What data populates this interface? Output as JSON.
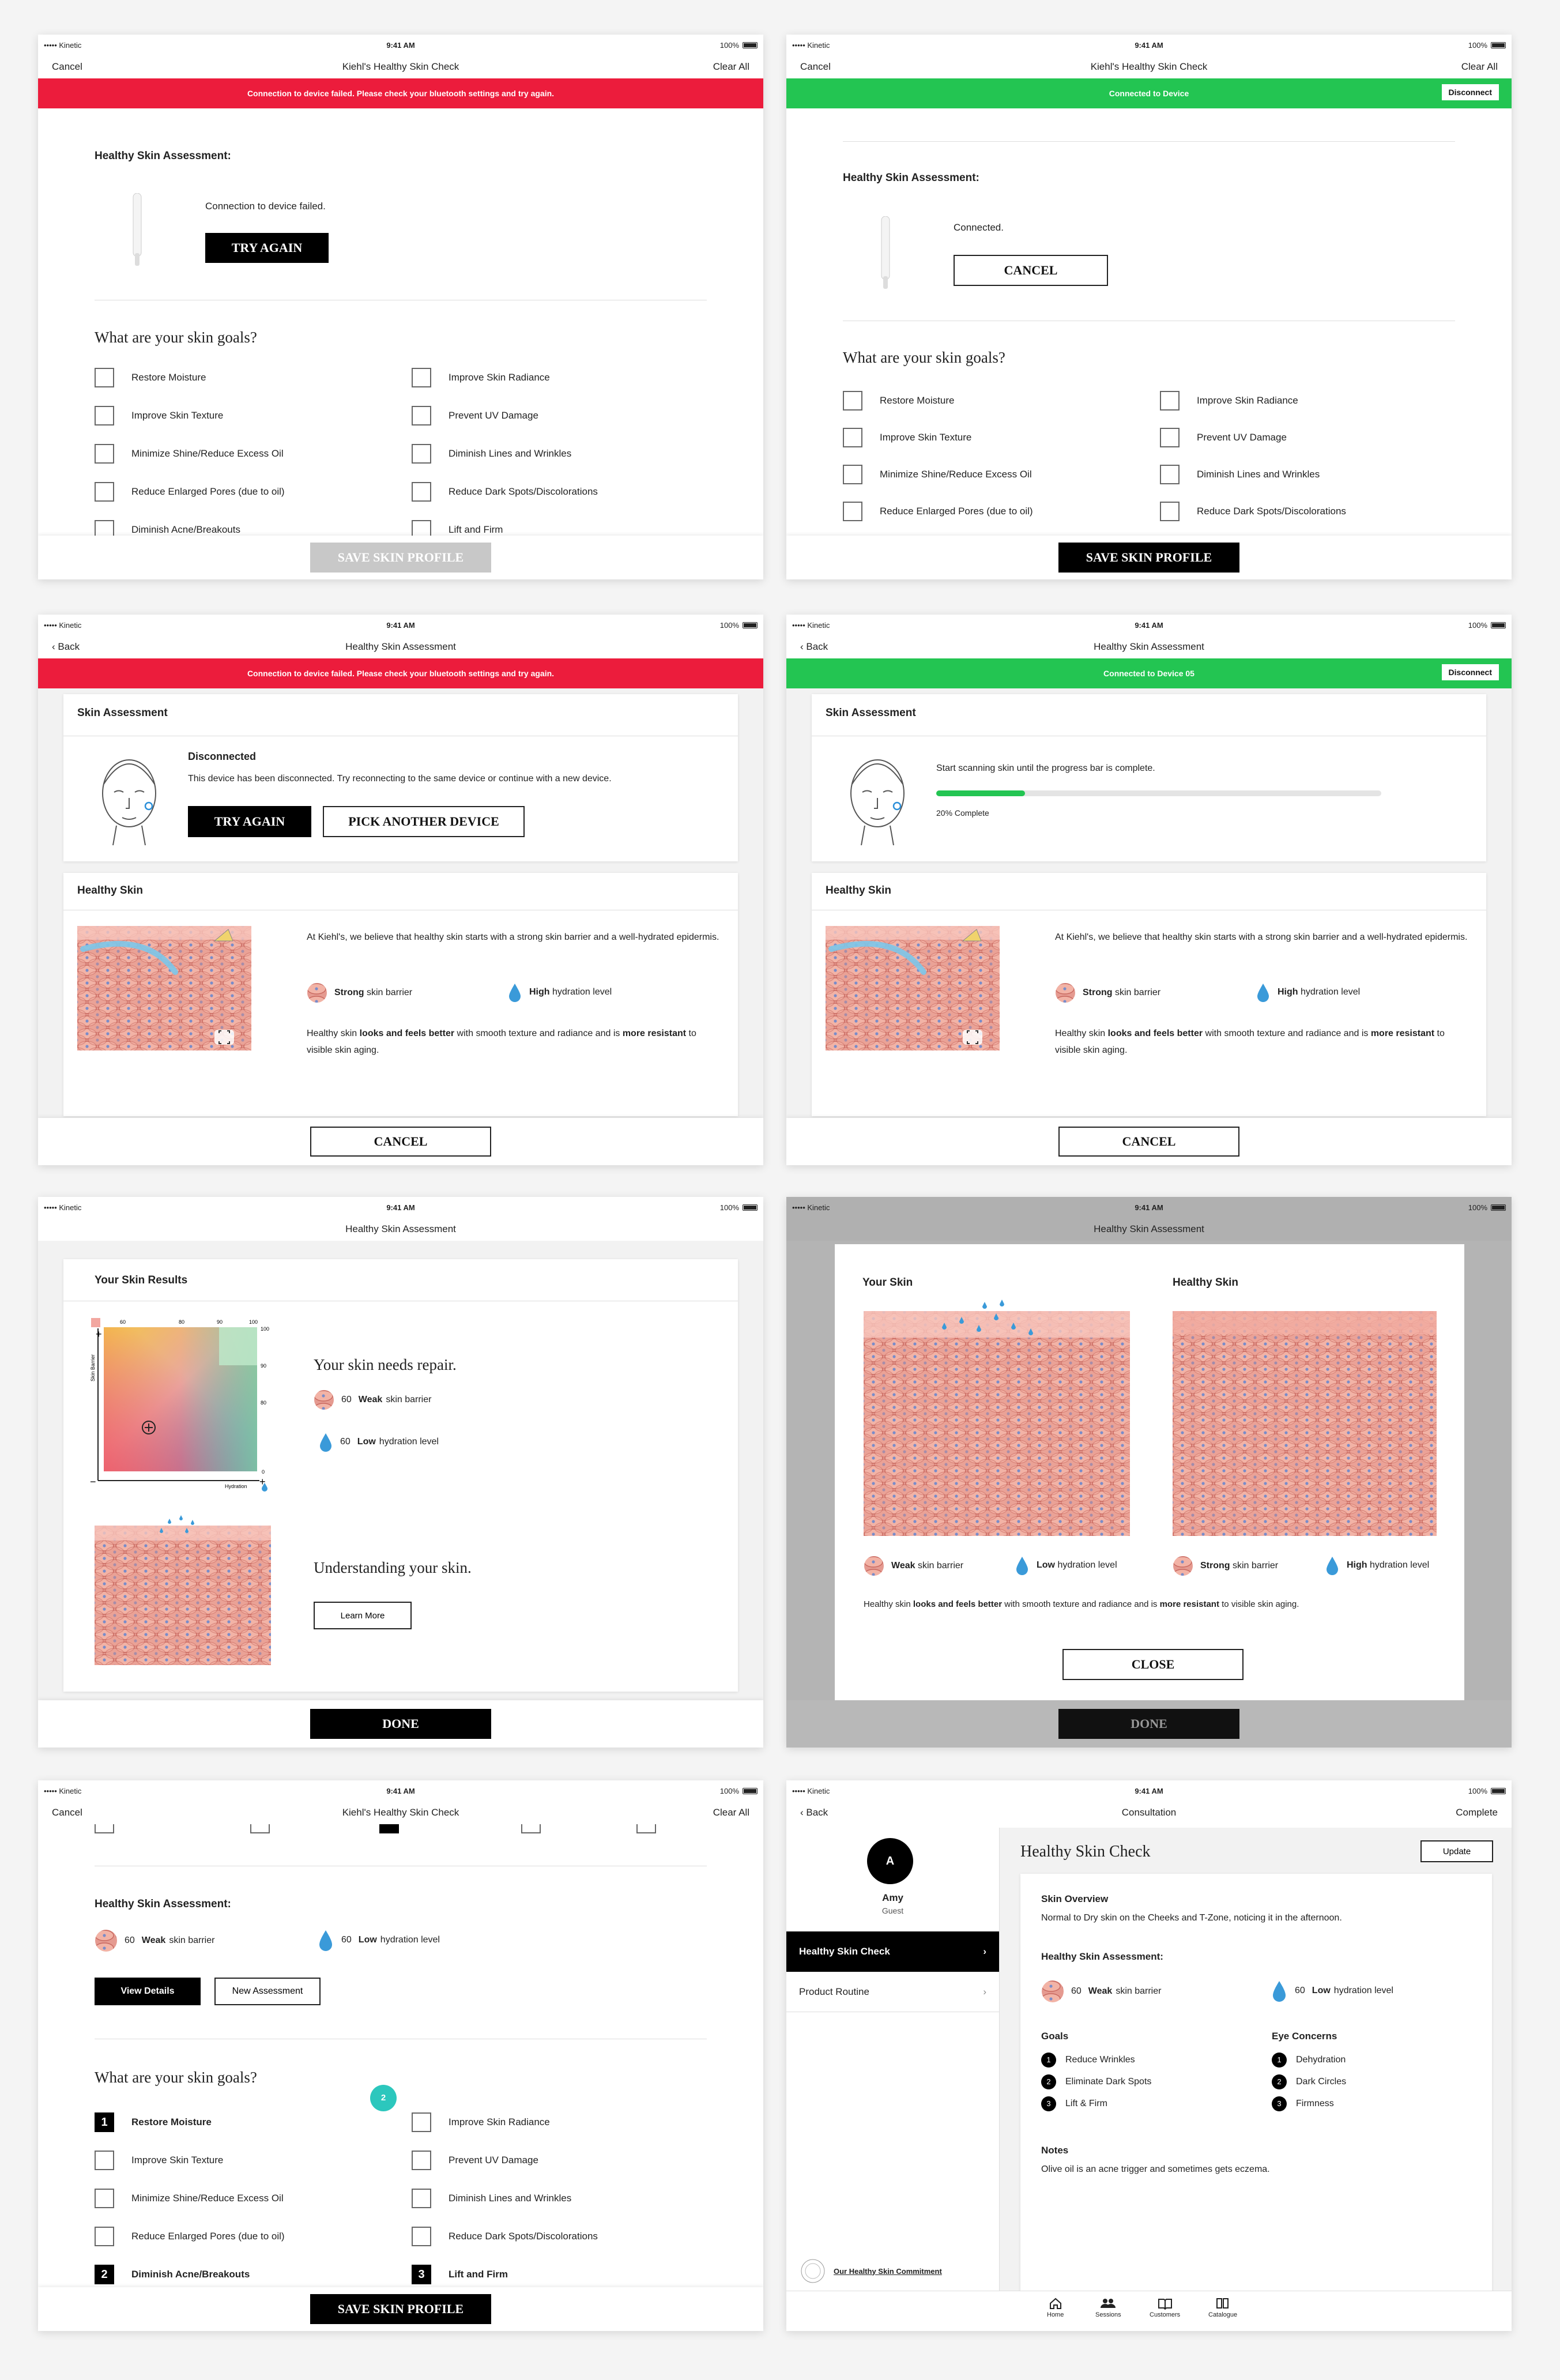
{
  "status": {
    "carrier": "••••• Kinetic",
    "time": "9:41 AM",
    "battery": "100%"
  },
  "s1": {
    "nav": {
      "left": "Cancel",
      "title": "Kiehl's Healthy Skin Check",
      "right": "Clear All"
    },
    "banner": "Connection to device failed. Please check your bluetooth settings and try again.",
    "heading": "Healthy Skin Assessment:",
    "msg": "Connection to device failed.",
    "btn": "TRY AGAIN",
    "goals_title": "What are your skin goals?",
    "goals": [
      "Restore Moisture",
      "Improve Skin Radiance",
      "Improve Skin Texture",
      "Prevent UV Damage",
      "Minimize Shine/Reduce Excess Oil",
      "Diminish Lines and Wrinkles",
      "Reduce Enlarged Pores (due to oil)",
      "Reduce Dark Spots/Discolorations",
      "Diminish Acne/Breakouts",
      "Lift and Firm"
    ],
    "save": "SAVE SKIN PROFILE"
  },
  "s2": {
    "nav": {
      "left": "Cancel",
      "title": "Kiehl's Healthy Skin Check",
      "right": "Clear All"
    },
    "banner": "Connected to Device",
    "disconnect": "Disconnect",
    "heading": "Healthy Skin Assessment:",
    "msg": "Connected.",
    "btn": "CANCEL",
    "goals_title": "What are your skin goals?",
    "goals": [
      "Restore Moisture",
      "Improve Skin Radiance",
      "Improve Skin Texture",
      "Prevent UV Damage",
      "Minimize Shine/Reduce Excess Oil",
      "Diminish Lines and Wrinkles",
      "Reduce Enlarged Pores (due to oil)",
      "Reduce Dark Spots/Discolorations"
    ],
    "save": "SAVE SKIN PROFILE"
  },
  "s3": {
    "nav": {
      "left": "Back",
      "title": "Healthy Skin Assessment"
    },
    "banner": "Connection to device failed. Please check your bluetooth settings and try again.",
    "sa": "Skin Assessment",
    "disc_title": "Disconnected",
    "disc_msg": "This device has been disconnected. Try reconnecting to the same device or continue with a new device.",
    "try": "TRY AGAIN",
    "pick": "PICK ANOTHER DEVICE",
    "hs": "Healthy Skin",
    "p1": "At Kiehl's, we believe that healthy skin starts with a strong skin barrier and a well-hydrated epidermis.",
    "barrier_b": "Strong",
    "barrier": "skin barrier",
    "hyd_b": "High",
    "hyd": "hydration level",
    "p2a": "Healthy skin ",
    "p2b": "looks and feels better",
    "p2c": " with smooth texture and radiance and is ",
    "p2d": "more resistant",
    "p2e": " to visible skin aging.",
    "cancel": "CANCEL"
  },
  "s4": {
    "nav": {
      "left": "Back",
      "title": "Healthy Skin Assessment"
    },
    "banner": "Connected to Device 05",
    "disconnect": "Disconnect",
    "sa": "Skin Assessment",
    "scan": "Start scanning skin until the progress bar is complete.",
    "progress": 0.2,
    "complete": "20% Complete",
    "hs": "Healthy Skin",
    "p1": "At Kiehl's, we believe that healthy skin starts with a strong skin barrier and a well-hydrated epidermis.",
    "barrier_b": "Strong",
    "barrier": "skin barrier",
    "hyd_b": "High",
    "hyd": "hydration level",
    "p2a": "Healthy skin ",
    "p2b": "looks and feels better",
    "p2c": " with smooth texture and radiance and is ",
    "p2d": "more resistant",
    "p2e": " to visible skin aging.",
    "cancel": "CANCEL"
  },
  "s5": {
    "nav": {
      "title": "Healthy Skin Assessment"
    },
    "title": "Your Skin Results",
    "ticks_top": [
      "60",
      "80",
      "90",
      "100"
    ],
    "ticks_right": [
      "100",
      "90",
      "80"
    ],
    "tick_zero": "0",
    "y_axis": "Skin Barrier",
    "x_axis": "Hydration",
    "plus": "+",
    "minus": "−",
    "repair": "Your skin needs repair.",
    "v1": "60",
    "v1b": "Weak",
    "v1t": "skin barrier",
    "v2": "60",
    "v2b": "Low",
    "v2t": "hydration level",
    "understand": "Understanding your skin.",
    "learn": "Learn More",
    "done": "DONE"
  },
  "s6": {
    "nav": {
      "title": "Healthy Skin Assessment"
    },
    "your": "Your Skin",
    "healthy": "Healthy Skin",
    "l1b": "Weak",
    "l1": "skin barrier",
    "l2b": "Low",
    "l2": "hydration level",
    "l3b": "Strong",
    "l3": "skin barrier",
    "l4b": "High",
    "l4": "hydration level",
    "p2a": "Healthy skin ",
    "p2b": "looks and feels better",
    "p2c": " with smooth texture and radiance and is ",
    "p2d": "more resistant",
    "p2e": " to visible skin aging.",
    "close": "CLOSE",
    "done": "DONE"
  },
  "s7": {
    "nav": {
      "left": "Cancel",
      "title": "Kiehl's Healthy Skin Check",
      "right": "Clear All"
    },
    "heading": "Healthy Skin Assessment:",
    "v1": "60",
    "v1b": "Weak",
    "v1t": "skin barrier",
    "v2": "60",
    "v2b": "Low",
    "v2t": "hydration level",
    "details": "View Details",
    "newa": "New Assessment",
    "goals_title": "What are your skin goals?",
    "badge": "2",
    "goals": [
      {
        "n": "1",
        "label": "Restore Moisture",
        "on": true
      },
      {
        "n": "",
        "label": "Improve Skin Radiance",
        "on": false
      },
      {
        "n": "",
        "label": "Improve Skin Texture",
        "on": false
      },
      {
        "n": "",
        "label": "Prevent UV Damage",
        "on": false
      },
      {
        "n": "",
        "label": "Minimize Shine/Reduce Excess Oil",
        "on": false
      },
      {
        "n": "",
        "label": "Diminish Lines and Wrinkles",
        "on": false
      },
      {
        "n": "",
        "label": "Reduce Enlarged Pores (due to oil)",
        "on": false
      },
      {
        "n": "",
        "label": "Reduce Dark Spots/Discolorations",
        "on": false
      },
      {
        "n": "2",
        "label": "Diminish Acne/Breakouts",
        "on": true
      },
      {
        "n": "3",
        "label": "Lift and Firm",
        "on": true
      }
    ],
    "save": "SAVE SKIN PROFILE"
  },
  "s8": {
    "nav": {
      "left": "Back",
      "title": "Consultation",
      "right": "Complete"
    },
    "avatar": "A",
    "name": "Amy",
    "role": "Guest",
    "menu": [
      "Healthy Skin Check",
      "Product Routine"
    ],
    "commit": "Our Healthy Skin Commitment",
    "title": "Healthy Skin Check",
    "update": "Update",
    "ov_h": "Skin Overview",
    "ov": "Normal to Dry skin on the Cheeks and T-Zone, noticing it in the afternoon.",
    "assess_h": "Healthy Skin Assessment:",
    "v1": "60",
    "v1b": "Weak",
    "v1t": "skin barrier",
    "v2": "60",
    "v2b": "Low",
    "v2t": "hydration level",
    "goals_h": "Goals",
    "goals": [
      "Reduce Wrinkles",
      "Eliminate Dark Spots",
      "Lift & Firm"
    ],
    "eye_h": "Eye Concerns",
    "eyes": [
      "Dehydration",
      "Dark Circles",
      "Firmness"
    ],
    "notes_h": "Notes",
    "notes": "Olive oil is an acne trigger and sometimes gets eczema.",
    "tabs": [
      "Home",
      "Sessions",
      "Customers",
      "Catalogue"
    ]
  }
}
